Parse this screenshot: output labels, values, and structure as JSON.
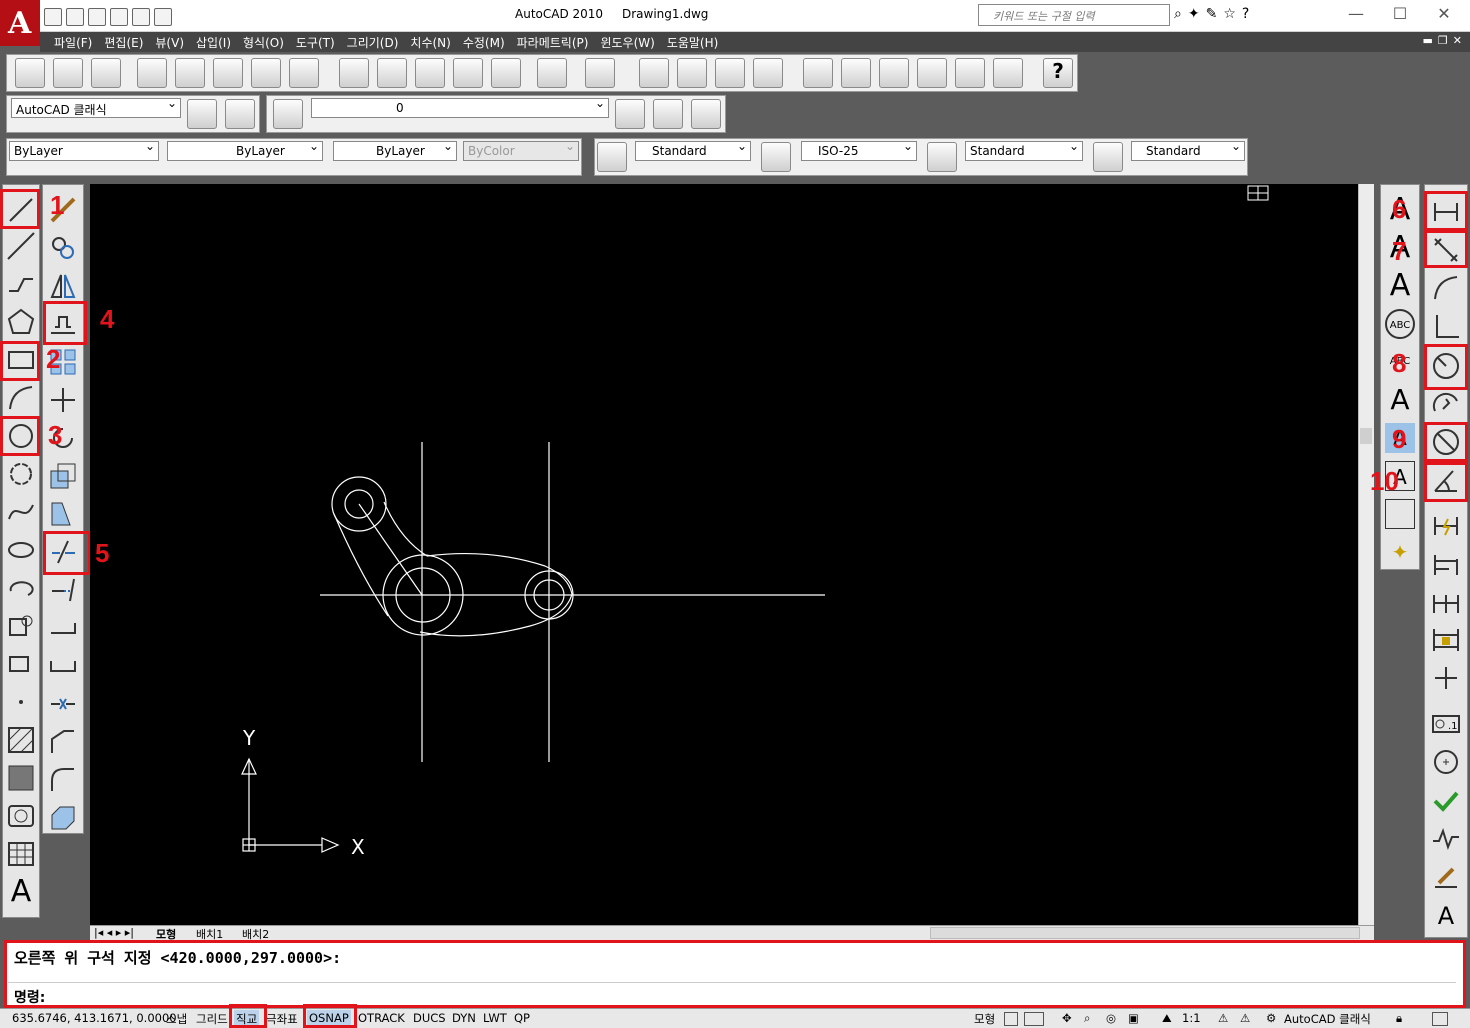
{
  "window": {
    "app_name": "AutoCAD 2010",
    "file_name": "Drawing1.dwg",
    "search_placeholder": "키워드 또는 구절 입력"
  },
  "menu": [
    "파일(F)",
    "편집(E)",
    "뷰(V)",
    "삽입(I)",
    "형식(O)",
    "도구(T)",
    "그리기(D)",
    "치수(N)",
    "수정(M)",
    "파라메트릭(P)",
    "윈도우(W)",
    "도움말(H)"
  ],
  "workspace": {
    "name": "AutoCAD 클래식",
    "layer": "0"
  },
  "properties": {
    "color": "ByLayer",
    "linetype": "ByLayer",
    "lineweight": "ByLayer",
    "plotstyle": "ByColor"
  },
  "styles": {
    "text_style": "Standard",
    "dim_style": "ISO-25",
    "table_style": "Standard",
    "mleader_style": "Standard"
  },
  "annotations": [
    "1",
    "2",
    "3",
    "4",
    "5",
    "6",
    "7",
    "8",
    "9",
    "10"
  ],
  "canvas": {
    "ucs_y": "Y",
    "ucs_x": "X"
  },
  "layout_tabs": [
    "모형",
    "배치1",
    "배치2"
  ],
  "command": {
    "prompt": "오른쪽 위 구석 지정 <420.0000,297.0000>:",
    "input_label": "명령:"
  },
  "status": {
    "coords": "635.6746, 413.1671, 0.0000",
    "toggles": [
      {
        "label": "스냅",
        "on": false
      },
      {
        "label": "그리드",
        "on": false
      },
      {
        "label": "직교",
        "on": true
      },
      {
        "label": "극좌표",
        "on": false
      },
      {
        "label": "OSNAP",
        "on": true
      },
      {
        "label": "OTRACK",
        "on": false
      },
      {
        "label": "DUCS",
        "on": false
      },
      {
        "label": "DYN",
        "on": false
      },
      {
        "label": "LWT",
        "on": false
      },
      {
        "label": "QP",
        "on": false
      }
    ],
    "model_label": "모형",
    "scale": "1:1",
    "workspace": "AutoCAD 클래식"
  },
  "colors": {
    "highlight": "#e1141b",
    "canvas": "#000000",
    "brand": "#b40f14"
  }
}
